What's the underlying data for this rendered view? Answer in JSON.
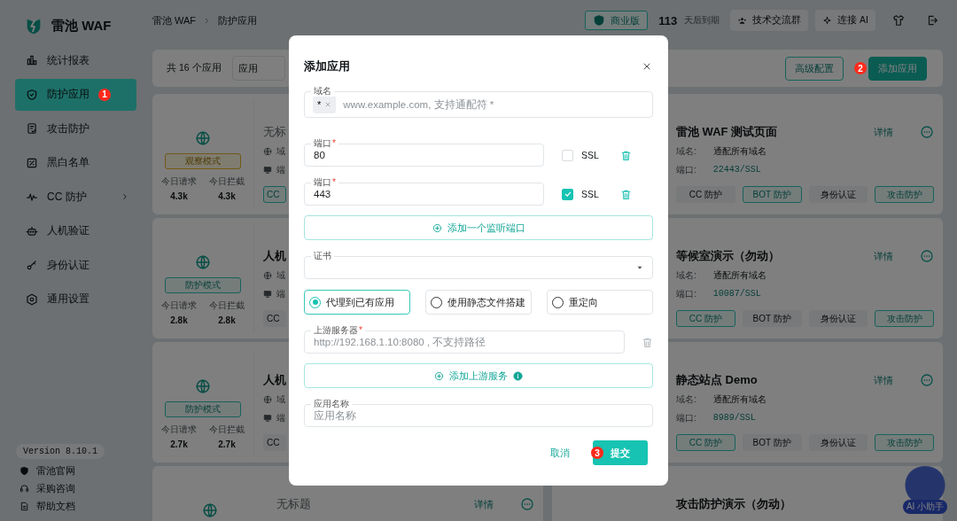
{
  "sidebar": {
    "brand": "雷池 WAF",
    "items": [
      {
        "label": "统计报表",
        "selected": false,
        "expandable": false
      },
      {
        "label": "防护应用",
        "selected": true,
        "expandable": false,
        "badge": "1"
      },
      {
        "label": "攻击防护",
        "selected": false,
        "expandable": false
      },
      {
        "label": "黑白名单",
        "selected": false,
        "expandable": false
      },
      {
        "label": "CC 防护",
        "selected": false,
        "expandable": true
      },
      {
        "label": "人机验证",
        "selected": false,
        "expandable": false
      },
      {
        "label": "身份认证",
        "selected": false,
        "expandable": false
      },
      {
        "label": "通用设置",
        "selected": false,
        "expandable": false
      }
    ],
    "version": "Version 8.10.1",
    "links": [
      "雷池官网",
      "采购咨询",
      "帮助文档"
    ]
  },
  "header": {
    "breadcrumb": [
      "雷池 WAF",
      "防护应用"
    ],
    "edition": "商业版",
    "days": "113",
    "days_label": "天后到期",
    "actions": [
      "技术交流群",
      "连接 AI"
    ]
  },
  "toolbar": {
    "count": "共 16 个应用",
    "filter": "应用",
    "buttons": [
      {
        "label": "高级配置",
        "kind": "outline"
      },
      {
        "label": "添加应用",
        "kind": "primary",
        "badge": "2"
      }
    ]
  },
  "left_cards": [
    {
      "mode": "观察模式",
      "kind": "observe",
      "stats": [
        {
          "label": "今日请求",
          "value": "4.3k"
        },
        {
          "label": "今日拦截",
          "value": "4.3k"
        }
      ],
      "title": "无标",
      "untitled": true,
      "fields": [
        "域",
        "端"
      ],
      "chip": {
        "label": "CC",
        "on": true
      }
    },
    {
      "mode": "防护模式",
      "kind": "protect",
      "stats": [
        {
          "label": "今日请求",
          "value": "2.8k"
        },
        {
          "label": "今日拦截",
          "value": "2.8k"
        }
      ],
      "title": "人机",
      "untitled": false,
      "fields": [
        "域",
        "端"
      ],
      "chip": {
        "label": "CC",
        "on": false
      }
    },
    {
      "mode": "防护模式",
      "kind": "protect",
      "stats": [
        {
          "label": "今日请求",
          "value": "2.7k"
        },
        {
          "label": "今日拦截",
          "value": "2.7k"
        }
      ],
      "title": "人机",
      "untitled": false,
      "fields": [
        "域",
        "端"
      ],
      "chip": {
        "label": "CC",
        "on": false
      }
    },
    {
      "title": "无标题",
      "untitled": true,
      "link": "详情"
    }
  ],
  "right_cards": [
    {
      "title": "雷池 WAF 测试页面",
      "link": "详情",
      "fields": [
        {
          "label": "域名:",
          "value": "通配所有域名",
          "kind": "text"
        },
        {
          "label": "端口:",
          "value": "22443/SSL",
          "kind": "port"
        }
      ],
      "chips": [
        {
          "label": "CC 防护",
          "on": false
        },
        {
          "label": "BOT 防护",
          "on": true
        },
        {
          "label": "身份认证",
          "on": false
        },
        {
          "label": "攻击防护",
          "on": true
        }
      ]
    },
    {
      "title": "等候室演示（勿动）",
      "link": "详情",
      "fields": [
        {
          "label": "域名:",
          "value": "通配所有域名",
          "kind": "text"
        },
        {
          "label": "端口:",
          "value": "10087/SSL",
          "kind": "port"
        }
      ],
      "chips": [
        {
          "label": "CC 防护",
          "on": true
        },
        {
          "label": "BOT 防护",
          "on": false
        },
        {
          "label": "身份认证",
          "on": false
        },
        {
          "label": "攻击防护",
          "on": true
        }
      ]
    },
    {
      "title": "静态站点 Demo",
      "link": "详情",
      "fields": [
        {
          "label": "域名:",
          "value": "通配所有域名",
          "kind": "text"
        },
        {
          "label": "端口:",
          "value": "8989/SSL",
          "kind": "port"
        }
      ],
      "chips": [
        {
          "label": "CC 防护",
          "on": true
        },
        {
          "label": "BOT 防护",
          "on": false
        },
        {
          "label": "身份认证",
          "on": false
        },
        {
          "label": "攻击防护",
          "on": true
        }
      ]
    },
    {
      "title": "攻击防护演示（勿动）"
    }
  ],
  "assistant": {
    "label": "AI 小助手"
  },
  "dialog": {
    "title": "添加应用",
    "required_mark": "*",
    "domain": {
      "label": "域名",
      "tags": [
        "*"
      ],
      "placeholder": "www.example.com, 支持通配符 *"
    },
    "ports": [
      {
        "label": "端口",
        "value": "80",
        "ssl_label": "SSL",
        "checked": false
      },
      {
        "label": "端口",
        "value": "443",
        "ssl_label": "SSL",
        "checked": true
      }
    ],
    "add_port": "添加一个监听端口",
    "certificate": {
      "label": "证书"
    },
    "modes": [
      {
        "label": "代理到已有应用",
        "selected": true
      },
      {
        "label": "使用静态文件搭建",
        "selected": false
      },
      {
        "label": "重定向",
        "selected": false
      }
    ],
    "upstream": {
      "label": "上游服务器",
      "placeholder": "http://192.168.1.10:8080 , 不支持路径"
    },
    "add_upstream": "添加上游服务",
    "app_name": {
      "label": "应用名称",
      "placeholder": "应用名称"
    },
    "cancel": "取消",
    "submit": {
      "label": "提交",
      "badge": "3"
    }
  }
}
